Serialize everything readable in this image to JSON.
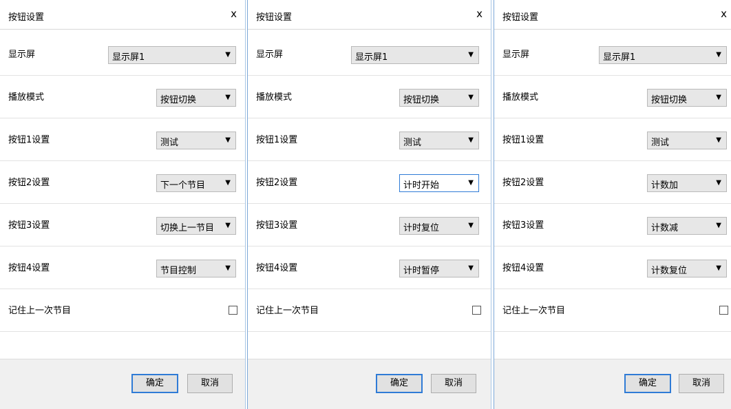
{
  "dialogs": [
    {
      "title": "按钮设置",
      "close": "x",
      "display_label": "显示屏",
      "display_value": "显示屏1",
      "mode_label": "播放模式",
      "mode_value": "按钮切换",
      "btn1_label": "按钮1设置",
      "btn1_value": "测试",
      "btn2_label": "按钮2设置",
      "btn2_value": "下一个节目",
      "btn3_label": "按钮3设置",
      "btn3_value": "切换上一节目",
      "btn4_label": "按钮4设置",
      "btn4_value": "节目控制",
      "remember_label": "记住上一次节目",
      "remember_checked": false,
      "ok": "确定",
      "cancel": "取消"
    },
    {
      "title": "按钮设置",
      "close": "x",
      "display_label": "显示屏",
      "display_value": "显示屏1",
      "mode_label": "播放模式",
      "mode_value": "按钮切换",
      "btn1_label": "按钮1设置",
      "btn1_value": "测试",
      "btn2_label": "按钮2设置",
      "btn2_value": "计时开始",
      "btn3_label": "按钮3设置",
      "btn3_value": "计时复位",
      "btn4_label": "按钮4设置",
      "btn4_value": "计时暂停",
      "remember_label": "记住上一次节目",
      "remember_checked": false,
      "ok": "确定",
      "cancel": "取消"
    },
    {
      "title": "按钮设置",
      "close": "x",
      "display_label": "显示屏",
      "display_value": "显示屏1",
      "mode_label": "播放模式",
      "mode_value": "按钮切换",
      "btn1_label": "按钮1设置",
      "btn1_value": "测试",
      "btn2_label": "按钮2设置",
      "btn2_value": "计数加",
      "btn3_label": "按钮3设置",
      "btn3_value": "计数减",
      "btn4_label": "按钮4设置",
      "btn4_value": "计数复位",
      "remember_label": "记住上一次节目",
      "remember_checked": false,
      "ok": "确定",
      "cancel": "取消"
    }
  ],
  "icons": {
    "dropdown_arrow": "chevron-down-icon",
    "close": "close-icon"
  },
  "colors": {
    "focus_border": "#2f7bd6",
    "panel_border": "#7aa7d8",
    "select_bg": "#e7e7e7",
    "footer_bg": "#f0f0f0"
  }
}
